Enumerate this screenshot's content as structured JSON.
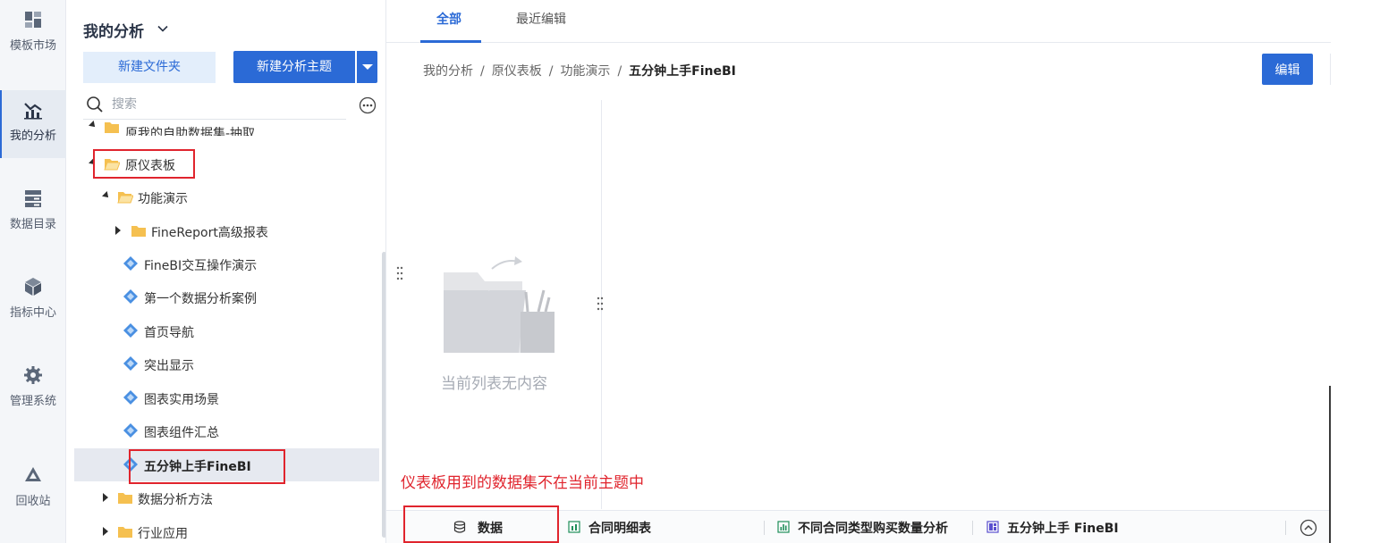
{
  "rail": {
    "items": [
      {
        "label": "模板市场",
        "icon": "dashboard-grid-icon"
      },
      {
        "label": "我的分析",
        "icon": "analysis-chart-icon",
        "active": true
      },
      {
        "label": "数据目录",
        "icon": "data-catalog-icon"
      },
      {
        "label": "指标中心",
        "icon": "metrics-cube-icon"
      },
      {
        "label": "管理系统",
        "icon": "gear-icon"
      },
      {
        "label": "回收站",
        "icon": "recycle-bin-icon"
      }
    ]
  },
  "panel": {
    "title": "我的分析",
    "new_folder_label": "新建文件夹",
    "new_topic_label": "新建分析主题",
    "search_placeholder": "搜索"
  },
  "tree": {
    "items": [
      {
        "label": "原我的自助数据集-抽取",
        "type": "folder",
        "expanded": false
      },
      {
        "label": "原仪表板",
        "type": "folder",
        "expanded": true
      },
      {
        "label": "功能演示",
        "type": "folder",
        "expanded": true
      },
      {
        "label": "FineReport高级报表",
        "type": "folder",
        "expanded": false
      },
      {
        "label": "FineBI交互操作演示",
        "type": "dashboard"
      },
      {
        "label": "第一个数据分析案例",
        "type": "dashboard"
      },
      {
        "label": "首页导航",
        "type": "dashboard"
      },
      {
        "label": "突出显示",
        "type": "dashboard"
      },
      {
        "label": "图表实用场景",
        "type": "dashboard"
      },
      {
        "label": "图表组件汇总",
        "type": "dashboard"
      },
      {
        "label": "五分钟上手FineBI",
        "type": "dashboard",
        "selected": true
      },
      {
        "label": "数据分析方法",
        "type": "folder",
        "expanded": false
      },
      {
        "label": "行业应用",
        "type": "folder",
        "expanded": false
      }
    ]
  },
  "main": {
    "tabs": [
      {
        "label": "全部",
        "active": true
      },
      {
        "label": "最近编辑"
      }
    ],
    "breadcrumb": [
      "我的分析",
      "原仪表板",
      "功能演示"
    ],
    "breadcrumb_current": "五分钟上手FineBI",
    "breadcrumb_sep": "/",
    "edit_label": "编辑",
    "empty_text": "当前列表无内容",
    "warning_text": "仪表板用到的数据集不在当前主题中",
    "bottom_tabs": [
      {
        "label": "数据",
        "icon": "database-icon"
      },
      {
        "label": "合同明细表",
        "icon": "table-sheet-icon"
      },
      {
        "label": "不同合同类型购买数量分析",
        "icon": "bar-chart-icon"
      },
      {
        "label": "五分钟上手 FineBI",
        "icon": "dashboard-layout-icon"
      }
    ]
  },
  "colors": {
    "accent": "#2b6ad6",
    "highlight_red": "#e0242d",
    "folder_yellow": "#f5c050",
    "dashboard_blue": "#4a90e2"
  }
}
